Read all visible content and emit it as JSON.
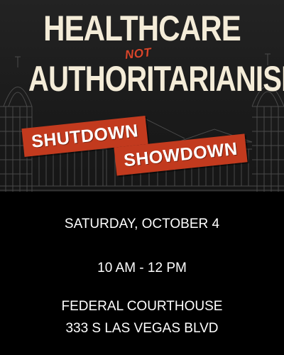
{
  "poster": {
    "headline_line1": "HEALTHCARE",
    "connector": "NOT",
    "headline_line2": "AUTHORITARIANISM",
    "banner_line1": "SHUTDOWN",
    "banner_line2": "SHOWDOWN",
    "date": "SATURDAY, OCTOBER 4",
    "time": "10 AM - 12 PM",
    "venue": "FEDERAL COURTHOUSE",
    "address": "333 S LAS VEGAS BLVD"
  },
  "colors": {
    "background": "#000000",
    "header_background": "#1e1e1e",
    "headline": "#f4ecd8",
    "accent_red": "#c23a1e",
    "text": "#ffffff"
  },
  "icons": {
    "background_illustration": "capitol-building-icon"
  }
}
